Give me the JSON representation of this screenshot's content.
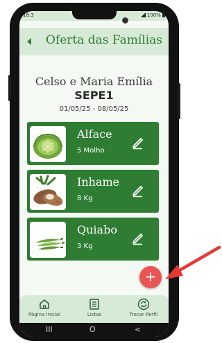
{
  "status": {
    "time": "18:3",
    "battery": "100%"
  },
  "header": {
    "title": "Oferta das Famílias"
  },
  "offer": {
    "family": "Celso e Maria Emília",
    "group": "SEPE1",
    "period": "01/05/25 - 08/05/25"
  },
  "products": [
    {
      "name": "Alface",
      "quantity": "5 Molho",
      "image": "lettuce-image"
    },
    {
      "name": "Inhame",
      "quantity": "8 Kg",
      "image": "yam-image"
    },
    {
      "name": "Quiabo",
      "quantity": "3 Kg",
      "image": "okra-image"
    }
  ],
  "fab": {
    "label": "+"
  },
  "nav": [
    {
      "label": "Página Inicial",
      "icon": "home-icon"
    },
    {
      "label": "Listas",
      "icon": "list-icon"
    },
    {
      "label": "Trocar Perfil",
      "icon": "switch-profile-icon"
    }
  ],
  "system_nav": {
    "recents": "III",
    "home": "O",
    "back": "<"
  },
  "colors": {
    "primary": "#2e7d32",
    "bar": "#d7ead8",
    "background": "#f4faf3",
    "fab": "#ea5455",
    "annotation_arrow": "#e53935"
  }
}
